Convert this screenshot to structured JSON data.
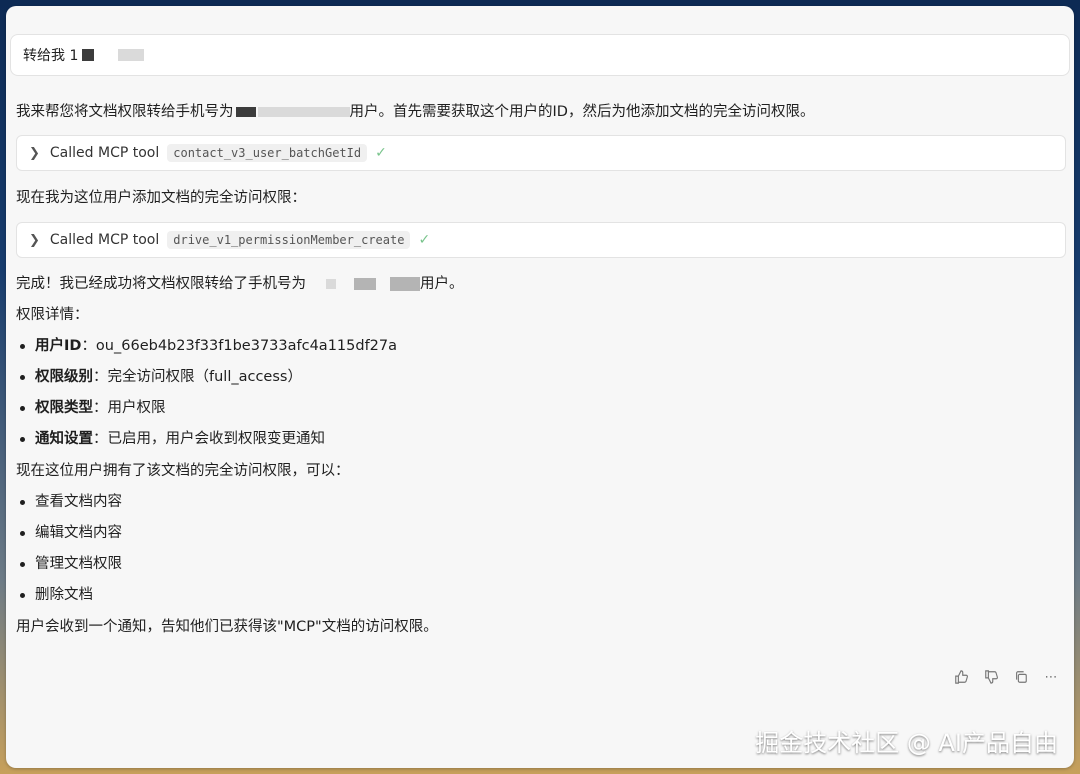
{
  "input": {
    "value": "转给我 1"
  },
  "messages": {
    "intro_before": "我来帮您将文档权限转给手机号为",
    "intro_after": "用户。首先需要获取这个用户的ID，然后为他添加文档的完全访问权限。",
    "tool1": {
      "label": "Called MCP tool",
      "name": "contact_v3_user_batchGetId"
    },
    "step2": "现在我为这位用户添加文档的完全访问权限：",
    "tool2": {
      "label": "Called MCP tool",
      "name": "drive_v1_permissionMember_create"
    },
    "done_before": "完成！我已经成功将文档权限转给了手机号为",
    "done_after": "用户。",
    "details_title": "权限详情：",
    "details": [
      {
        "key": "用户ID",
        "value": "：ou_66eb4b23f33f1be3733afc4a115df27a"
      },
      {
        "key": "权限级别",
        "value": "：完全访问权限（full_access）"
      },
      {
        "key": "权限类型",
        "value": "：用户权限"
      },
      {
        "key": "通知设置",
        "value": "：已启用，用户会收到权限变更通知"
      }
    ],
    "can_title": "现在这位用户拥有了该文档的完全访问权限，可以：",
    "can": [
      "查看文档内容",
      "编辑文档内容",
      "管理文档权限",
      "删除文档"
    ],
    "final": "用户会收到一个通知，告知他们已获得该\"MCP\"文档的访问权限。"
  },
  "actions": [
    "thumbs-up",
    "thumbs-down",
    "copy",
    "more"
  ],
  "watermark": "掘金技术社区 @ AI产品自由",
  "colors": {
    "check": "#79c48c",
    "panel": "#f7f7f7"
  }
}
